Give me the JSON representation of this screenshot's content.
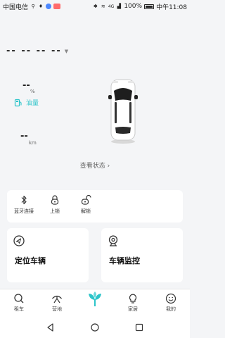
{
  "status_bar": {
    "carrier": "中国电信",
    "battery": "100%",
    "time": "中午11:08",
    "signal": "4G"
  },
  "vehicle": {
    "plate": "-- -- -- --",
    "fuel_value": "--",
    "fuel_unit": "%",
    "fuel_label": "油量",
    "mileage_value": "--",
    "mileage_unit": "km",
    "status_link": "查看状态"
  },
  "quick_actions": [
    {
      "label": "蓝牙连接",
      "icon": "bluetooth-icon"
    },
    {
      "label": "上锁",
      "icon": "lock-icon"
    },
    {
      "label": "解锁",
      "icon": "unlock-icon"
    }
  ],
  "features": {
    "locate": {
      "title": "定位车辆",
      "icon": "locate-icon"
    },
    "monitor": {
      "title": "车辆监控",
      "icon": "camera-icon"
    }
  },
  "tabbar": [
    {
      "label": "租车",
      "icon": "search-icon"
    },
    {
      "label": "营地",
      "icon": "camp-icon"
    },
    {
      "label": "",
      "icon": "home-plant-icon"
    },
    {
      "label": "家居",
      "icon": "bulb-icon"
    },
    {
      "label": "我的",
      "icon": "smile-icon"
    }
  ],
  "colors": {
    "accent": "#2bc4c9",
    "background": "#f4f5f7",
    "card": "#ffffff"
  }
}
